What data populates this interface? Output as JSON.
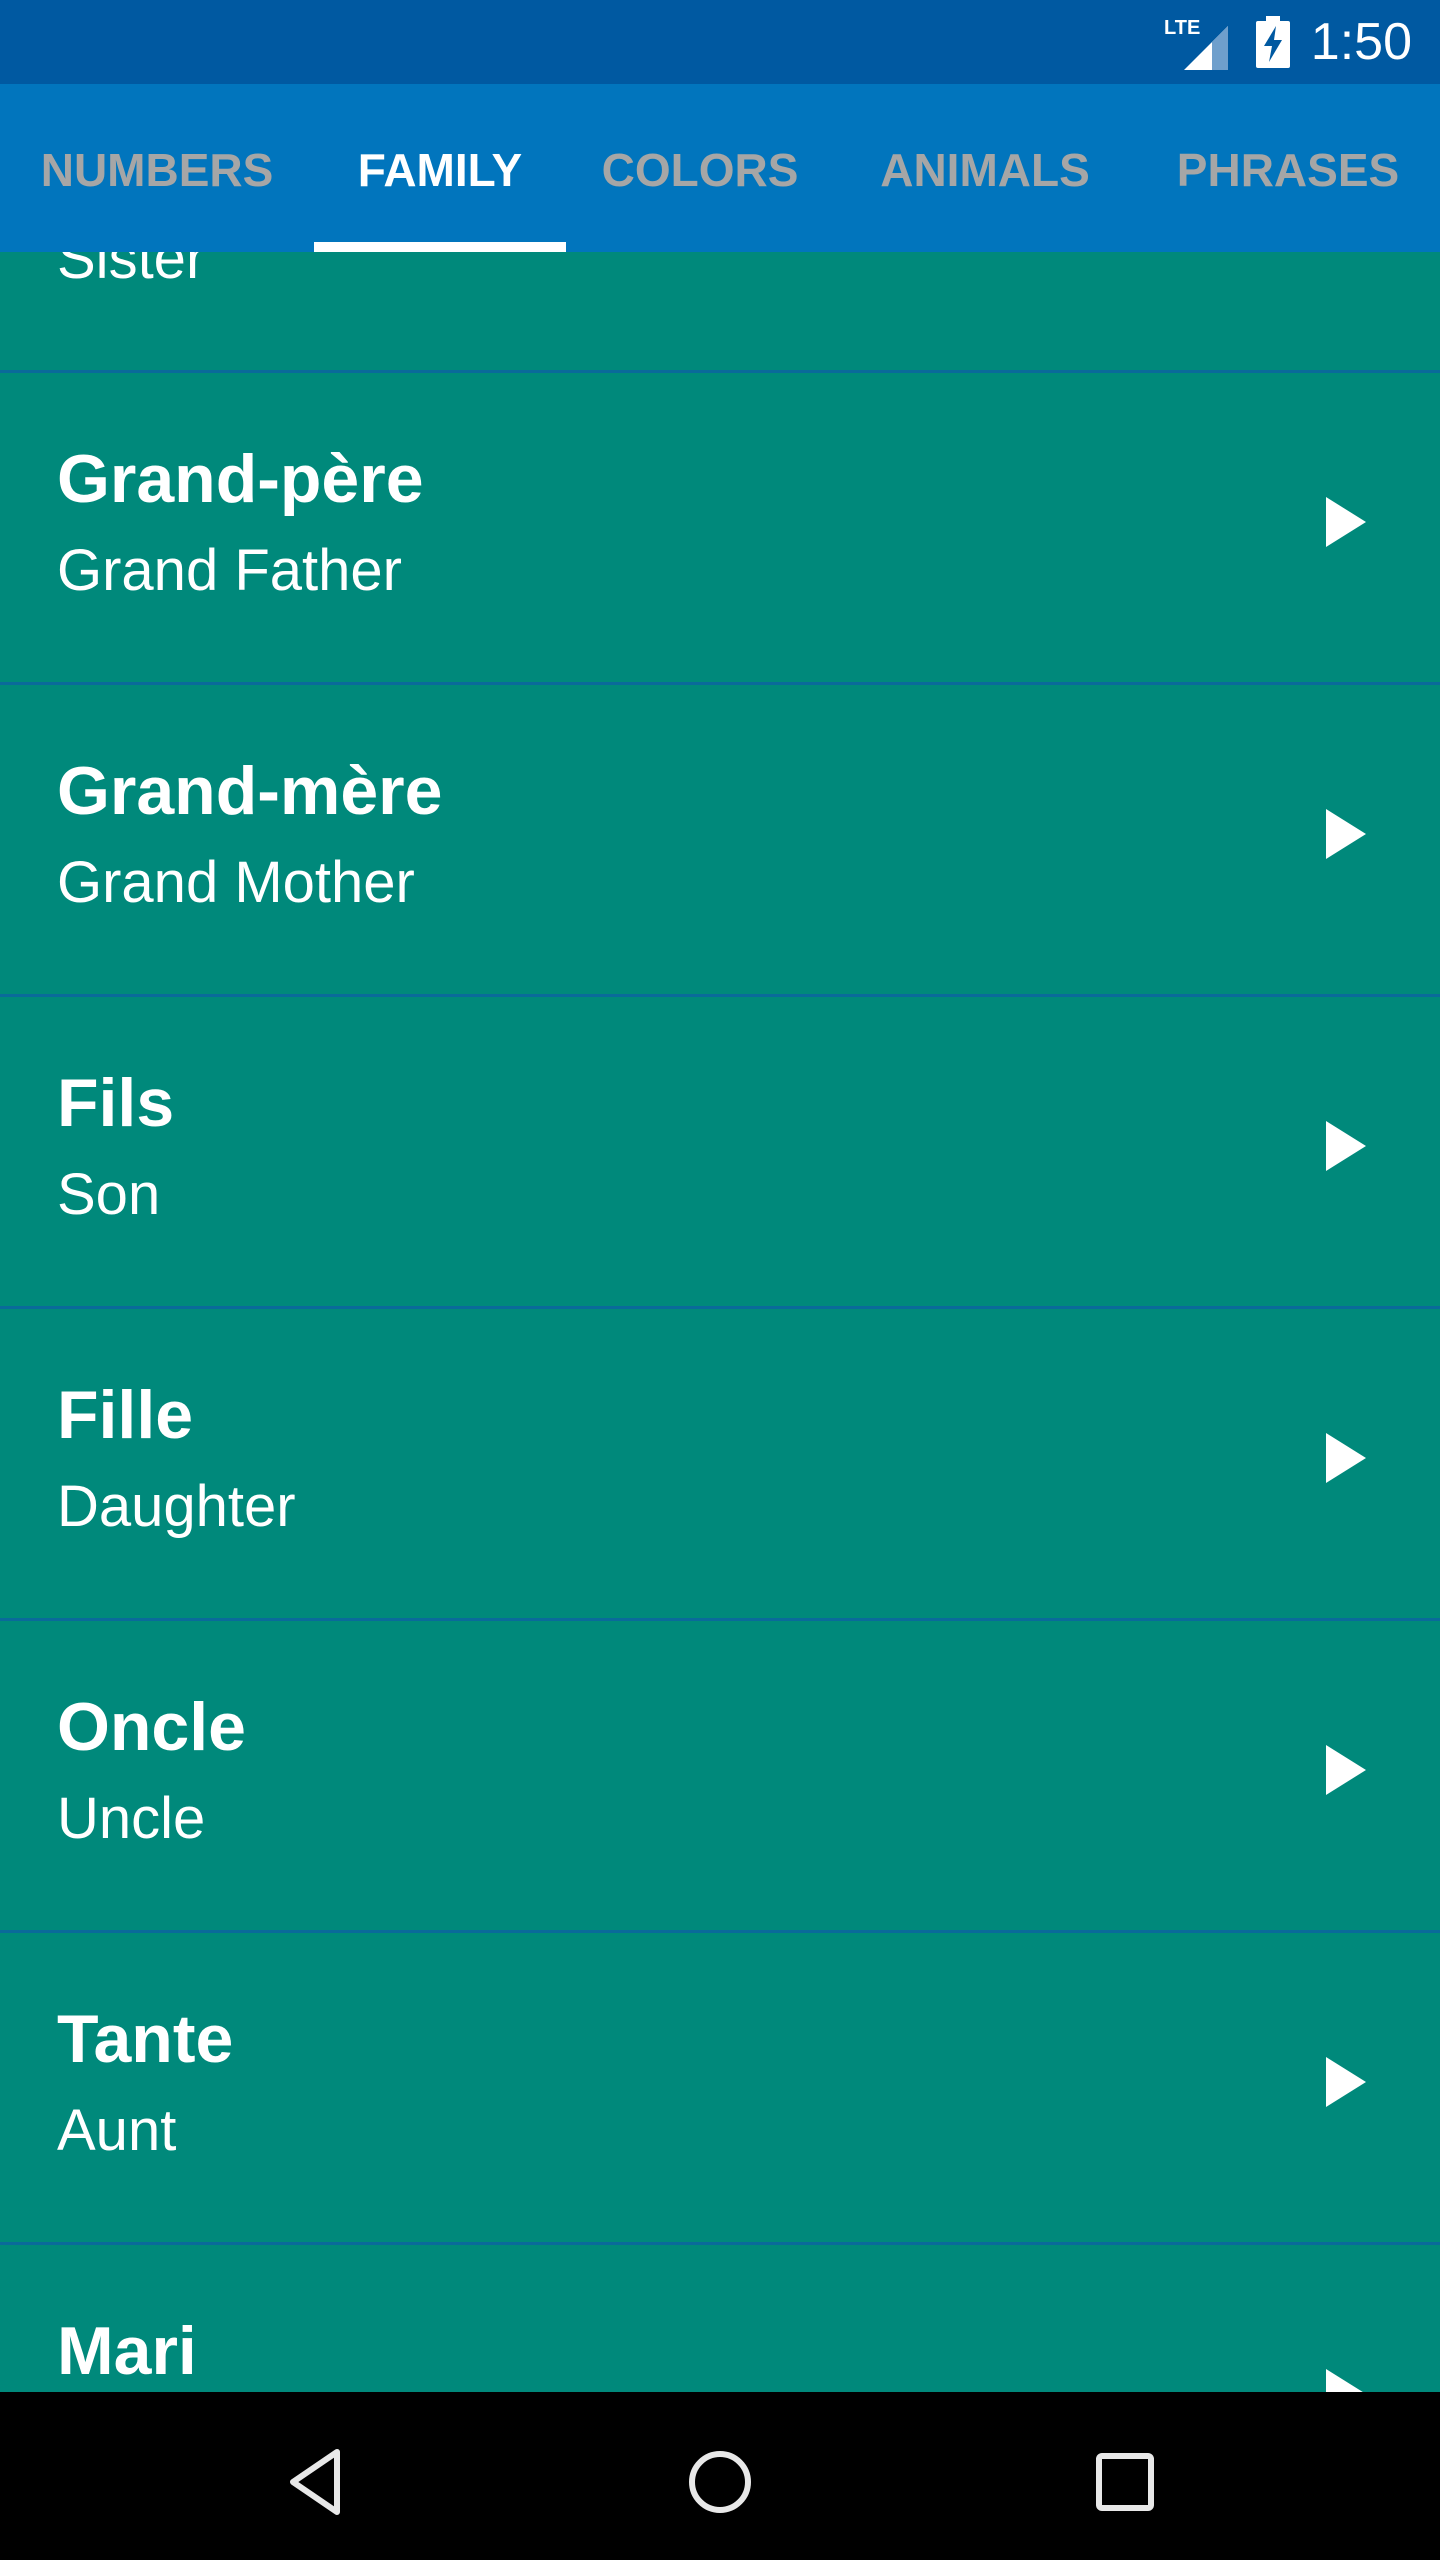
{
  "status_bar": {
    "time": "1:50",
    "network": "LTE",
    "icons": [
      "lte-signal-icon",
      "battery-charging-icon"
    ]
  },
  "tabs": [
    {
      "label": "NUMBERS",
      "active": false
    },
    {
      "label": "FAMILY",
      "active": true
    },
    {
      "label": "COLORS",
      "active": false
    },
    {
      "label": "ANIMALS",
      "active": false
    },
    {
      "label": "PHRASES",
      "active": false
    }
  ],
  "list": {
    "items": [
      {
        "french": "",
        "english": "Sister"
      },
      {
        "french": "Grand-père",
        "english": "Grand Father"
      },
      {
        "french": "Grand-mère",
        "english": "Grand Mother"
      },
      {
        "french": "Fils",
        "english": "Son"
      },
      {
        "french": "Fille",
        "english": "Daughter"
      },
      {
        "french": "Oncle",
        "english": "Uncle"
      },
      {
        "french": "Tante",
        "english": "Aunt"
      },
      {
        "french": "Mari",
        "english": ""
      }
    ],
    "item_icon": "play-icon"
  },
  "colors": {
    "status_bar": "#0059a1",
    "tab_bar": "#0175bd",
    "list_bg": "#00897b",
    "divider": "#0a6a9a",
    "inactive_tab": "#a6a6a6"
  },
  "nav_bar": {
    "icons": [
      "back-icon",
      "home-icon",
      "recents-icon"
    ]
  }
}
